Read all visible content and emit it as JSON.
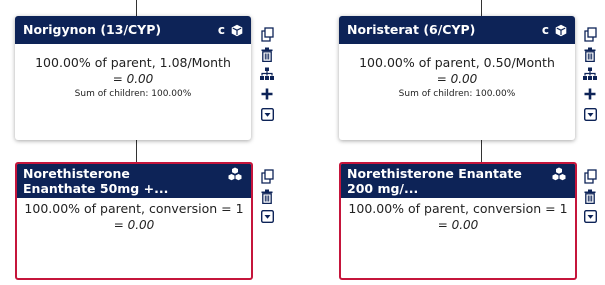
{
  "colors": {
    "header_bg": "#0d2357",
    "child_border": "#c5153b",
    "icon": "#0d2357"
  },
  "cards": {
    "norigynon": {
      "title": "Norigynon (13/CYP)",
      "badge": "c",
      "icon": "cube-icon",
      "main": "100.00% of parent, 1.08/Month",
      "value": "= 0.00",
      "sum": "Sum of children: 100.00%"
    },
    "noristerat": {
      "title": "Noristerat (6/CYP)",
      "badge": "c",
      "icon": "cube-icon",
      "main": "100.00% of parent, 0.50/Month",
      "value": "= 0.00",
      "sum": "Sum of children: 100.00%"
    },
    "enanthate": {
      "title": "Norethisterone Enanthate 50mg +...",
      "icon": "cubes-icon",
      "main": "100.00% of parent, conversion = 1",
      "value": "= 0.00"
    },
    "enantate": {
      "title": "Norethisterone Enantate 200 mg/...",
      "icon": "cubes-icon",
      "main": "100.00% of parent, conversion = 1",
      "value": "= 0.00"
    }
  },
  "toolbar_icons": {
    "top": [
      "copy-icon",
      "trash-icon",
      "sitemap-icon",
      "plus-icon",
      "caret-down-icon"
    ],
    "child": [
      "copy-icon",
      "trash-icon",
      "caret-down-icon"
    ]
  }
}
